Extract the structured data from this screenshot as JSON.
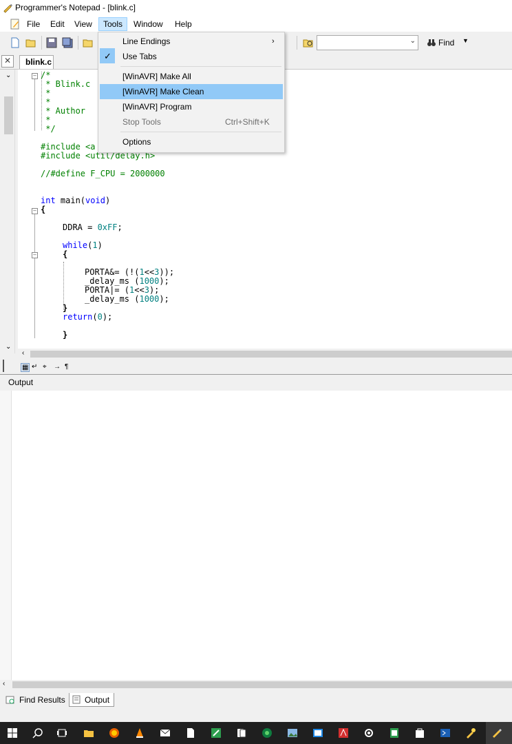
{
  "window": {
    "title": "Programmer's Notepad - [blink.c]"
  },
  "menubar": [
    "File",
    "Edit",
    "View",
    "Tools",
    "Window",
    "Help"
  ],
  "toolbar": {
    "find_label": "Find",
    "combo_value": ""
  },
  "tabs": {
    "active": "blink.c"
  },
  "tools_menu": {
    "line_endings": "Line Endings",
    "use_tabs": "Use Tabs",
    "make_all": "[WinAVR] Make All",
    "make_clean": "[WinAVR] Make Clean",
    "program": "[WinAVR] Program",
    "stop_tools": "Stop Tools",
    "stop_tools_shortcut": "Ctrl+Shift+K",
    "options": "Options"
  },
  "code": {
    "l1": "/*",
    "l2": " * Blink.c",
    "l3": " *",
    "l4": " *",
    "l5": " * Author",
    "l6": " *",
    "l7": " */",
    "inc1": "#include <a",
    "inc2": "#include <util/delay.h>",
    "define": "//#define F_CPU = 2000000",
    "main_kw": "int",
    "main_rest": " main(",
    "main_void": "void",
    "main_close": ")",
    "brace_open": "{",
    "ddra": "DDRA = ",
    "ddra_val": "0xFF",
    "ddra_end": ";",
    "while_kw": "while",
    "while_open": "(",
    "while_val": "1",
    "while_close": ")",
    "while_brace": "{",
    "porta1": "PORTA&= (!(",
    "porta1_n1": "1",
    "porta1_mid": "<<",
    "porta1_n2": "3",
    "porta1_end": "));",
    "delay1": "_delay_ms (",
    "delay1_val": "1000",
    "delay1_end": ");",
    "porta2": "PORTA|= (",
    "porta2_n1": "1",
    "porta2_mid": "<<",
    "porta2_n2": "3",
    "porta2_end": ");",
    "delay2": "_delay_ms (",
    "delay2_val": "1000",
    "delay2_end": ");",
    "while_brace_close": "}",
    "return_kw": "return",
    "return_open": "(",
    "return_val": "0",
    "return_end": ");",
    "brace_close": "}"
  },
  "output_pane": {
    "title": "Output"
  },
  "bottom_tabs": {
    "find_results": "Find Results",
    "output": "Output"
  },
  "colors": {
    "accent_highlight": "#91c9f7",
    "menu_active": "#cce8ff",
    "comment": "#008000",
    "keyword": "#0000ff",
    "number": "#008080"
  }
}
